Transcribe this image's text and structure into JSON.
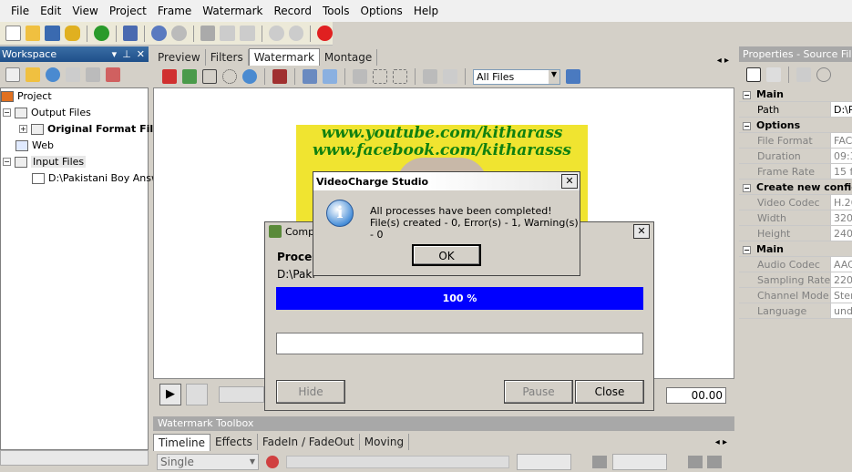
{
  "menu": [
    "File",
    "Edit",
    "View",
    "Project",
    "Frame",
    "Watermark",
    "Record",
    "Tools",
    "Options",
    "Help"
  ],
  "workspace": {
    "title": "Workspace",
    "tree": {
      "project": "Project",
      "output_files": "Output Files",
      "original_format": "Original Format File",
      "web": "Web",
      "input_files": "Input Files",
      "input_item": "D:\\Pakistani Boy Answ"
    }
  },
  "center_tabs": [
    "Preview",
    "Filters",
    "Watermark",
    "Montage"
  ],
  "active_center_tab": "Watermark",
  "filter_select": "All Files",
  "video_overlay": {
    "line1": "www.youtube.com/kitharass",
    "line2": "www.facebook.com/kitharasss"
  },
  "progress_dialog": {
    "title": "Comp",
    "label": "Proces",
    "path": "D:\\Paki",
    "percent_text": "100 %",
    "progress": 1.0,
    "hide": "Hide",
    "pause": "Pause",
    "close": "Close"
  },
  "message_box": {
    "title": "VideoCharge Studio",
    "line1": "All processes have been completed!",
    "line2": "File(s) created - 0, Error(s) - 1, Warning(s) - 0",
    "ok": "OK"
  },
  "transport": {
    "time": "00.00"
  },
  "watermark_toolbox": "Watermark Toolbox",
  "bottom_tabs": [
    "Timeline",
    "Effects",
    "FadeIn / FadeOut",
    "Moving"
  ],
  "single_select": "Single",
  "properties": {
    "title": "Properties - Source File",
    "rows": [
      {
        "type": "cat",
        "k": "Main"
      },
      {
        "k": "Path",
        "v": "D:\\P",
        "active": true
      },
      {
        "type": "cat",
        "k": "Options"
      },
      {
        "k": "File Format",
        "v": "FAC"
      },
      {
        "k": "Duration",
        "v": "09:3"
      },
      {
        "k": "Frame Rate",
        "v": "15 f"
      },
      {
        "type": "cat",
        "k": "Create new config"
      },
      {
        "k": "Video Codec",
        "v": "H.26"
      },
      {
        "k": "Width",
        "v": "320"
      },
      {
        "k": "Height",
        "v": "240"
      },
      {
        "type": "cat",
        "k": "Main"
      },
      {
        "k": "Audio Codec",
        "v": "AAC"
      },
      {
        "k": "Sampling Rate",
        "v": "220"
      },
      {
        "k": "Channel Mode",
        "v": "Ster"
      },
      {
        "k": "Language",
        "v": "und"
      }
    ]
  }
}
